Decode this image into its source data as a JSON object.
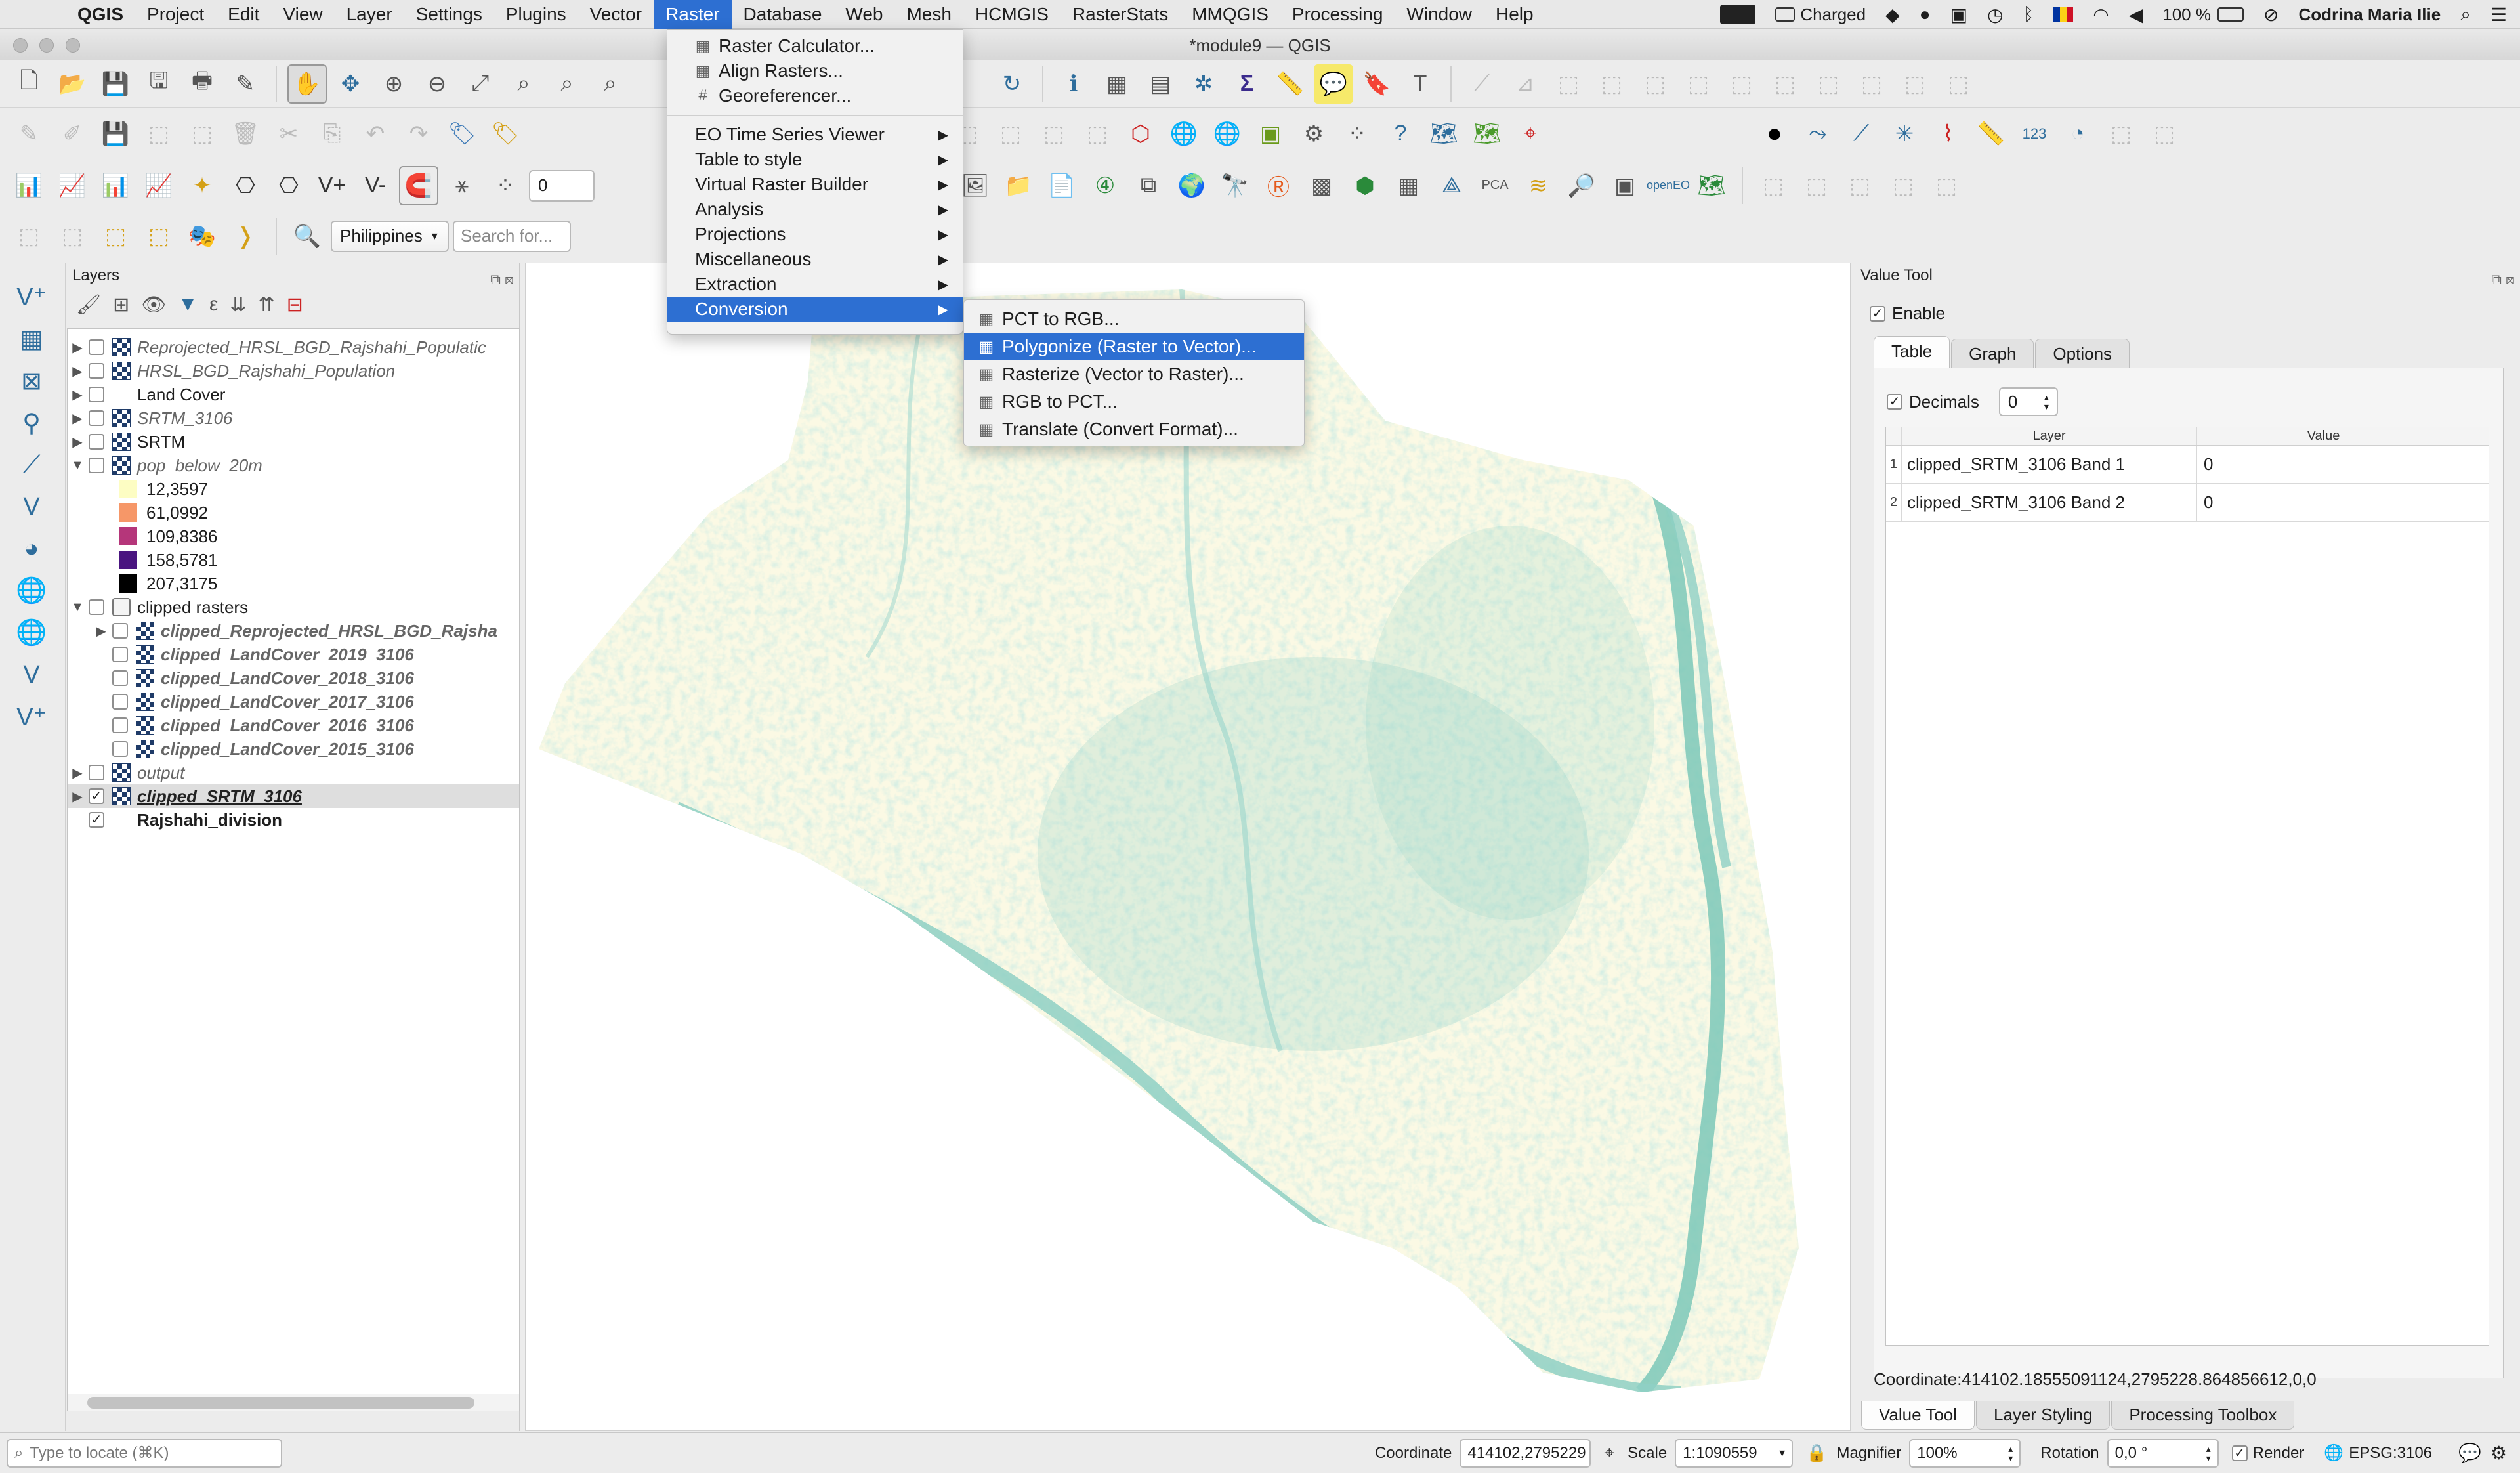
{
  "menubar": {
    "app": "QGIS",
    "items": [
      "Project",
      "Edit",
      "View",
      "Layer",
      "Settings",
      "Plugins",
      "Vector",
      "Raster",
      "Database",
      "Web",
      "Mesh",
      "HCMGIS",
      "RasterStats",
      "MMQGIS",
      "Processing",
      "Window",
      "Help"
    ],
    "battery_status": "Charged",
    "battery_percent": "100 %",
    "user": "Codrina Maria Ilie"
  },
  "window": {
    "title": "*module9 — QGIS"
  },
  "toolbar": {
    "snapping_tolerance": "0",
    "locale_combo": "Philippines",
    "search_placeholder": "Search for..."
  },
  "raster_menu": {
    "items": [
      {
        "label": "Raster Calculator...",
        "icon": "calculator-icon"
      },
      {
        "label": "Align Rasters...",
        "icon": "align-icon"
      },
      {
        "label": "Georeferencer...",
        "icon": "grid-icon"
      }
    ],
    "submenus": [
      "EO Time Series Viewer",
      "Table to style",
      "Virtual Raster Builder",
      "Analysis",
      "Projections",
      "Miscellaneous",
      "Extraction",
      "Conversion"
    ],
    "highlighted": "Conversion"
  },
  "conversion_menu": {
    "items": [
      "PCT to RGB...",
      "Polygonize (Raster to Vector)...",
      "Rasterize (Vector to Raster)...",
      "RGB to PCT...",
      "Translate (Convert Format)..."
    ],
    "highlighted": "Polygonize (Raster to Vector)..."
  },
  "layers_panel": {
    "title": "Layers",
    "layers": [
      {
        "name": "Reprojected_HRSL_BGD_Rajshahi_Populatic",
        "style": "it",
        "type": "raster",
        "twisty": "right",
        "checked": false
      },
      {
        "name": "HRSL_BGD_Rajshahi_Population",
        "style": "it",
        "type": "raster",
        "twisty": "right",
        "checked": false
      },
      {
        "name": "Land Cover",
        "style": "",
        "type": "vector",
        "twisty": "right",
        "checked": false
      },
      {
        "name": "SRTM_3106",
        "style": "it",
        "type": "raster",
        "twisty": "right",
        "checked": false
      },
      {
        "name": "SRTM",
        "style": "",
        "type": "raster",
        "twisty": "right",
        "checked": false
      },
      {
        "name": "pop_below_20m",
        "style": "it",
        "type": "raster",
        "twisty": "down",
        "checked": false
      }
    ],
    "legend": [
      {
        "value": "12,3597",
        "color": "#fdfdc3"
      },
      {
        "value": "61,0992",
        "color": "#f69768"
      },
      {
        "value": "109,8386",
        "color": "#b5367a"
      },
      {
        "value": "158,5781",
        "color": "#4a1580"
      },
      {
        "value": "207,3175",
        "color": "#000000"
      }
    ],
    "group": {
      "name": "clipped rasters",
      "checked": false
    },
    "group_children": [
      {
        "name": "clipped_Reprojected_HRSL_BGD_Rajsha",
        "twisty": true
      },
      {
        "name": "clipped_LandCover_2019_3106",
        "twisty": false
      },
      {
        "name": "clipped_LandCover_2018_3106",
        "twisty": false
      },
      {
        "name": "clipped_LandCover_2017_3106",
        "twisty": false
      },
      {
        "name": "clipped_LandCover_2016_3106",
        "twisty": false
      },
      {
        "name": "clipped_LandCover_2015_3106",
        "twisty": false
      }
    ],
    "tail": [
      {
        "name": "output",
        "style": "it",
        "twisty": "right",
        "checked": false,
        "selected": false
      },
      {
        "name": "clipped_SRTM_3106",
        "style": "bi",
        "twisty": "right",
        "checked": true,
        "selected": true
      },
      {
        "name": "Rajshahi_division",
        "style": "bd",
        "twisty": "",
        "checked": true,
        "selected": false
      }
    ]
  },
  "value_tool": {
    "title": "Value Tool",
    "enable_label": "Enable",
    "enabled": true,
    "tabs": [
      "Table",
      "Graph",
      "Options"
    ],
    "active_tab": "Table",
    "decimals_label": "Decimals",
    "decimals_value": "0",
    "columns": [
      "Layer",
      "Value"
    ],
    "rows": [
      {
        "idx": "1",
        "layer": "clipped_SRTM_3106 Band 1",
        "value": "0"
      },
      {
        "idx": "2",
        "layer": "clipped_SRTM_3106 Band 2",
        "value": "0"
      }
    ],
    "coordinate_readout": "Coordinate:414102.18555091124,2795228.864856612,0,0"
  },
  "dock_tabs": [
    "Value Tool",
    "Layer Styling",
    "Processing Toolbox"
  ],
  "statusbar": {
    "locate_placeholder": "Type to locate (⌘K)",
    "coordinate_label": "Coordinate",
    "coordinate_value": "414102,2795229",
    "scale_label": "Scale",
    "scale_value": "1:1090559",
    "magnifier_label": "Magnifier",
    "magnifier_value": "100%",
    "rotation_label": "Rotation",
    "rotation_value": "0,0 °",
    "render_label": "Render",
    "crs": "EPSG:3106"
  },
  "colors": {
    "menu_highlight": "#2d6fd2",
    "map_land": "#fbf9e4",
    "map_elev": "#8fd0c4"
  }
}
